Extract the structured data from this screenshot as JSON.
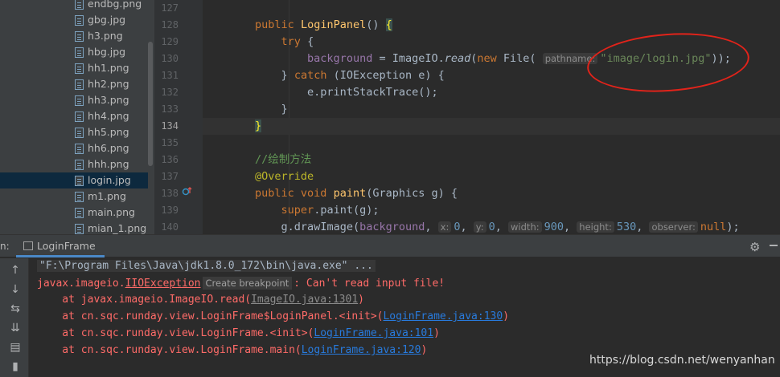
{
  "project_tree": {
    "items": [
      {
        "name": "endbg.png",
        "selected": false
      },
      {
        "name": "gbg.jpg",
        "selected": false
      },
      {
        "name": "h3.png",
        "selected": false
      },
      {
        "name": "hbg.jpg",
        "selected": false
      },
      {
        "name": "hh1.png",
        "selected": false
      },
      {
        "name": "hh2.png",
        "selected": false
      },
      {
        "name": "hh3.png",
        "selected": false
      },
      {
        "name": "hh4.png",
        "selected": false
      },
      {
        "name": "hh5.png",
        "selected": false
      },
      {
        "name": "hh6.png",
        "selected": false
      },
      {
        "name": "hhh.png",
        "selected": false
      },
      {
        "name": "login.jpg",
        "selected": true
      },
      {
        "name": "m1.png",
        "selected": false
      },
      {
        "name": "main.png",
        "selected": false
      },
      {
        "name": "mian_1.png",
        "selected": false
      }
    ]
  },
  "editor": {
    "line_numbers": [
      "127",
      "128",
      "129",
      "130",
      "131",
      "132",
      "133",
      "134",
      "135",
      "136",
      "137",
      "138",
      "139",
      "140"
    ],
    "current_line": "134",
    "code": {
      "l128_kw": "public",
      "l128_fn": "LoginPanel",
      "l128_paren": "() ",
      "l128_brace": "{",
      "l129_kw": "try",
      "l129_rest": " {",
      "l130_field": "background",
      "l130_eq": " = ImageIO.",
      "l130_read": "read",
      "l130_open": "(",
      "l130_new": "new",
      "l130_file": " File(",
      "l130_hint": "pathname:",
      "l130_str": "\"image/login.jpg\"",
      "l130_close": "));",
      "l131_open": "} ",
      "l131_catch": "catch",
      "l131_rest": " (IOException e) {",
      "l132": "e.printStackTrace();",
      "l133": "}",
      "l134": "}",
      "l136": "//绘制方法",
      "l137": "@Override",
      "l138_kw": "public void",
      "l138_fn": "paint",
      "l138_rest": "(Graphics g) {",
      "l139_kw": "super",
      "l139_rest": ".paint(g);",
      "l140_a": "g.drawImage(",
      "l140_field": "background",
      "l140_comma": ",",
      "l140_hx": "x:",
      "l140_vx": "0",
      "l140_hy": "y:",
      "l140_vy": "0",
      "l140_hw": "width:",
      "l140_vw": "900",
      "l140_hh": "height:",
      "l140_vh": "530",
      "l140_ho": "observer:",
      "l140_null": "null",
      "l140_end": ");"
    }
  },
  "run_panel": {
    "prefix": "n:",
    "tab_label": "LoginFrame",
    "console": {
      "cmd": "\"F:\\Program Files\\Java\\jdk1.8.0_172\\bin\\java.exe\" ...",
      "exc_pkg": "javax.imageio.",
      "exc_class": "IIOException",
      "create_breakpoint": "Create breakpoint",
      "exc_msg": ": Can't read input file!",
      "trace": [
        {
          "prefix": "    at javax.imageio.ImageIO.read(",
          "link": "ImageIO.java:1301",
          "suffix": ")",
          "link_color": "gray"
        },
        {
          "prefix": "    at cn.sqc.runday.view.LoginFrame$LoginPanel.<init>(",
          "link": "LoginFrame.java:130",
          "suffix": ")",
          "link_color": "blue"
        },
        {
          "prefix": "    at cn.sqc.runday.view.LoginFrame.<init>(",
          "link": "LoginFrame.java:101",
          "suffix": ")",
          "link_color": "blue"
        },
        {
          "prefix": "    at cn.sqc.runday.view.LoginFrame.main(",
          "link": "LoginFrame.java:120",
          "suffix": ")",
          "link_color": "blue"
        }
      ]
    }
  },
  "watermark": "https://blog.csdn.net/wenyanhan",
  "colors": {
    "annotation_circle": "#e2231a",
    "error_text": "#ff6b68",
    "link": "#287bde"
  }
}
